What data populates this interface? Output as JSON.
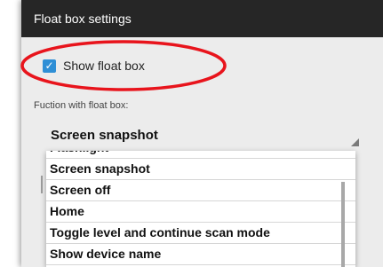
{
  "dialog": {
    "title": "Float box settings"
  },
  "show_float_box": {
    "label": "Show float box",
    "checked": true,
    "check_glyph": "✓"
  },
  "function_section": {
    "label": "Fuction with float box:",
    "selected_value": "Screen snapshot"
  },
  "dropdown": {
    "options": [
      "Flashlight",
      "Screen snapshot",
      "Screen off",
      "Home",
      "Toggle level and continue scan mode",
      "Show device name"
    ]
  },
  "colors": {
    "title_bar": "#262626",
    "checkbox_accent": "#2f8fd6",
    "annotation_ellipse": "#e8141c"
  }
}
